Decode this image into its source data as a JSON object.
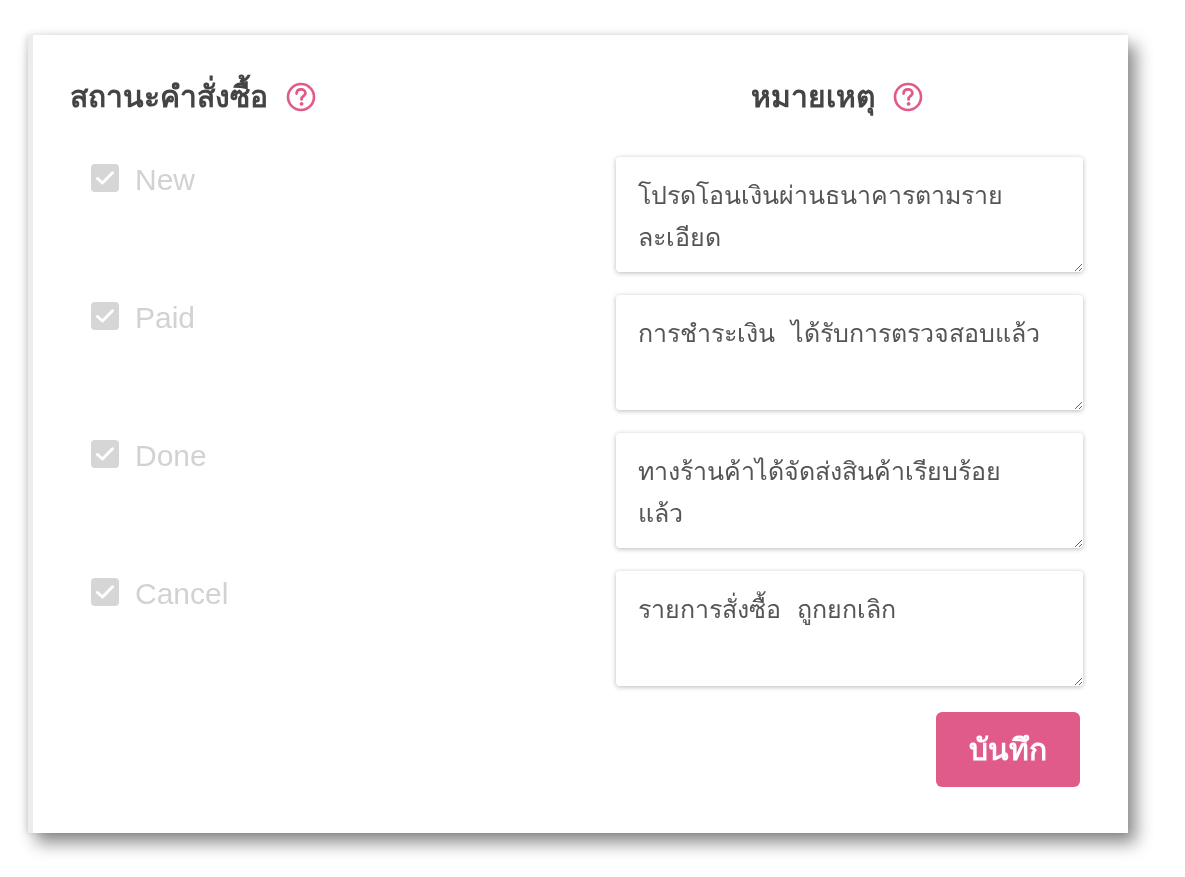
{
  "order_status": {
    "heading": "สถานะคำสั่งซื้อ"
  },
  "remarks": {
    "heading": "หมายเหตุ"
  },
  "statuses": [
    {
      "label": "New",
      "checked": true,
      "disabled": true,
      "remark": "โปรดโอนเงินผ่านธนาคารตามรายละเอียด"
    },
    {
      "label": "Paid",
      "checked": true,
      "disabled": true,
      "remark": "การชำระเงิน  ได้รับการตรวจสอบแล้ว"
    },
    {
      "label": "Done",
      "checked": true,
      "disabled": true,
      "remark": "ทางร้านค้าได้จัดส่งสินค้าเรียบร้อยแล้ว"
    },
    {
      "label": "Cancel",
      "checked": true,
      "disabled": true,
      "remark": "รายการสั่งซื้อ  ถูกยกเลิก"
    }
  ],
  "save_button": {
    "label": "บันทึก"
  }
}
